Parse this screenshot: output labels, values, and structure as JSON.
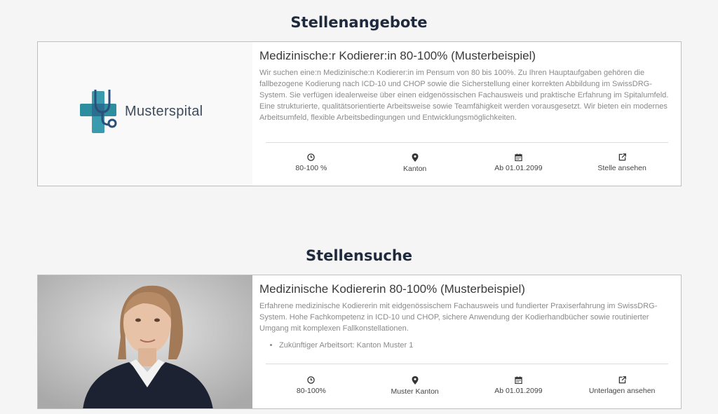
{
  "sections": {
    "offers_title": "Stellenangebote",
    "search_title": "Stellensuche"
  },
  "offer": {
    "logo_text": "Musterspital",
    "title": "Medizinische:r Kodierer:in 80-100% (Musterbeispiel)",
    "description": "Wir suchen eine:n Medizinische:n Kodierer:in im Pensum von 80 bis 100%. Zu Ihren Hauptaufgaben gehören die fallbezogene Kodierung nach ICD-10 und CHOP sowie die Sicherstellung einer korrekten Abbildung im SwissDRG-System. Sie verfügen idealerweise über einen eidgenössischen Fachausweis und praktische Erfahrung im Spitalumfeld. Eine strukturierte, qualitätsorientierte Arbeitsweise sowie Teamfähigkeit werden vorausgesetzt. Wir bieten ein modernes Arbeitsumfeld, flexible Arbeitsbedingungen und Entwicklungsmöglichkeiten.",
    "meta": {
      "workload": "80-100 %",
      "location": "Kanton",
      "start": "Ab 01.01.2099",
      "action": "Stelle ansehen"
    }
  },
  "search": {
    "title": "Medizinische Kodiererin 80-100% (Musterbeispiel)",
    "description": "Erfahrene medizinische Kodiererin mit eidgenössischem Fachausweis und fundierter Praxiserfahrung im SwissDRG-System. Hohe Fachkompetenz in ICD-10 und CHOP, sichere Anwendung der Kodierhandbücher sowie routinierter Umgang mit komplexen Fallkonstellationen.",
    "bullets": [
      "Zukünftiger Arbeitsort: Kanton Muster 1"
    ],
    "meta": {
      "workload": "80-100%",
      "location": "Muster Kanton",
      "start": "Ab 01.01.2099",
      "action": "Unterlagen ansehen"
    }
  },
  "colors": {
    "heading": "#1f2a3d",
    "logo_teal": "#2d8ea0",
    "logo_blue": "#2a4f78"
  }
}
